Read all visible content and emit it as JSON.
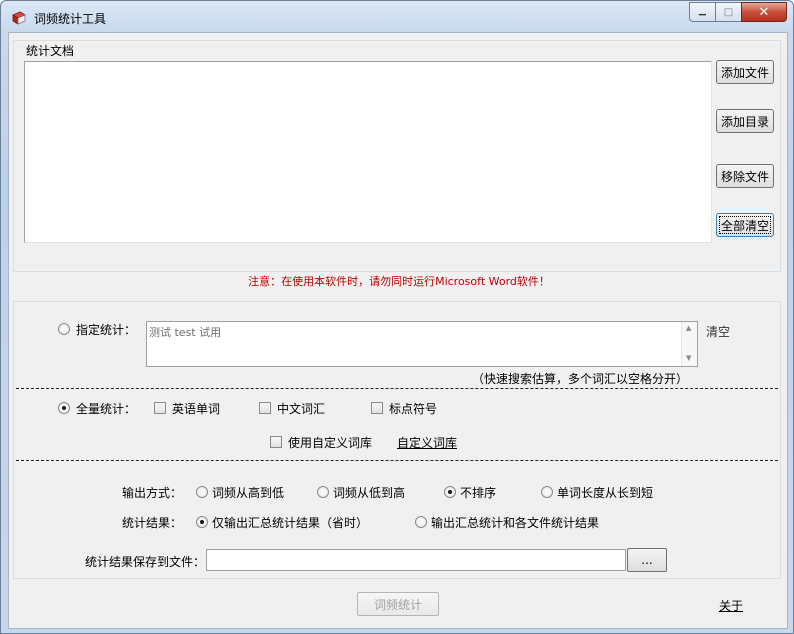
{
  "window": {
    "title": "词频统计工具",
    "caption": {
      "minimize": "▁",
      "maximize": "□",
      "close": "✕"
    }
  },
  "documents": {
    "group_label": "统计文档",
    "items": [],
    "buttons": {
      "add_file": "添加文件",
      "add_dir": "添加目录",
      "remove_file": "移除文件",
      "clear_all": "全部清空"
    }
  },
  "notice": "注意：在使用本软件时，请勿同时运行Microsoft Word软件！",
  "options": {
    "specified": {
      "label": "指定统计：",
      "checked": false,
      "text": "测试 test 试用",
      "clear_link": "清空",
      "hint": "（快速搜索估算，多个词汇以空格分开）"
    },
    "full": {
      "label": "全量统计：",
      "checked": true,
      "checks": {
        "english": {
          "label": "英语单词",
          "checked": false
        },
        "chinese": {
          "label": "中文词汇",
          "checked": false
        },
        "punct": {
          "label": "标点符号",
          "checked": false
        },
        "custom": {
          "label": "使用自定义词库",
          "checked": false
        }
      },
      "custom_link": "自定义词库"
    },
    "output_mode": {
      "label": "输出方式：",
      "choices": [
        {
          "label": "词频从高到低",
          "checked": false
        },
        {
          "label": "词频从低到高",
          "checked": false
        },
        {
          "label": "不排序",
          "checked": true
        },
        {
          "label": "单词长度从长到短",
          "checked": false
        }
      ]
    },
    "result": {
      "label": "统计结果：",
      "choices": [
        {
          "label": "仅输出汇总统计结果（省时）",
          "checked": true
        },
        {
          "label": "输出汇总统计和各文件统计结果",
          "checked": false
        }
      ]
    },
    "save": {
      "label": "统计结果保存到文件：",
      "value": "",
      "browse": "..."
    }
  },
  "footer": {
    "run": "词频统计",
    "about": "关于"
  }
}
